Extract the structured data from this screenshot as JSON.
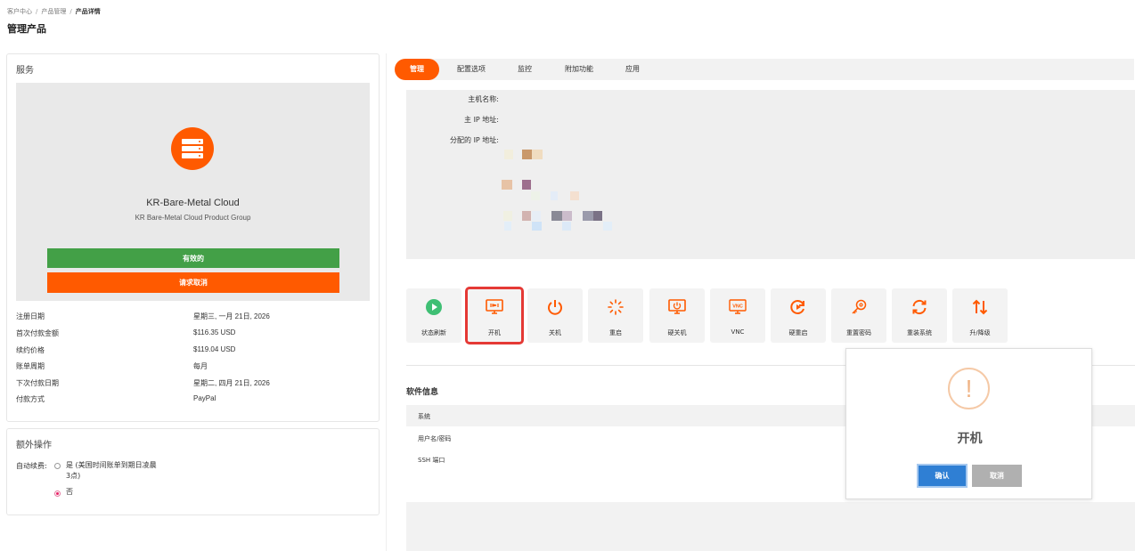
{
  "breadcrumb": {
    "items": [
      "客户中心",
      "产品管理",
      "产品详情"
    ],
    "separator": "/"
  },
  "page_title": "管理产品",
  "service_panel": {
    "title": "服务",
    "product_name": "KR-Bare-Metal Cloud",
    "product_group": "KR Bare-Metal Cloud Product Group",
    "status_label": "有效的",
    "cancel_request_label": "请求取消",
    "icon": "server-icon",
    "details": [
      {
        "key": "注册日期",
        "value": "星期三, 一月 21日, 2026"
      },
      {
        "key": "首次付款金额",
        "value": "$116.35 USD"
      },
      {
        "key": "续约价格",
        "value": "$119.04 USD"
      },
      {
        "key": "账单周期",
        "value": "每月"
      },
      {
        "key": "下次付款日期",
        "value": "星期二, 四月 21日, 2026"
      },
      {
        "key": "付款方式",
        "value": "PayPal"
      }
    ]
  },
  "extra_panel": {
    "title": "额外操作",
    "auto_renew_label": "自动续费:",
    "option_yes_line1": "是 (美国时间账单到期日凌晨",
    "option_yes_line2": "3点)",
    "option_no": "否",
    "selected": "no"
  },
  "tabs": [
    {
      "label": "管理",
      "active": true
    },
    {
      "label": "配置选项",
      "active": false
    },
    {
      "label": "监控",
      "active": false
    },
    {
      "label": "附加功能",
      "active": false
    },
    {
      "label": "应用",
      "active": false
    }
  ],
  "host_info": {
    "hostname_label": "主机名称:",
    "primary_ip_label": "主 IP 地址:",
    "assigned_ip_label": "分配的 IP 地址:"
  },
  "operations": [
    {
      "label": "状态刷新",
      "icon": "refresh-play-icon"
    },
    {
      "label": "开机",
      "icon": "monitor-power-on-icon"
    },
    {
      "label": "关机",
      "icon": "power-icon"
    },
    {
      "label": "重启",
      "icon": "spinner-icon"
    },
    {
      "label": "硬关机",
      "icon": "monitor-power-icon"
    },
    {
      "label": "VNC",
      "icon": "vnc-icon"
    },
    {
      "label": "硬重启",
      "icon": "hard-restart-icon"
    },
    {
      "label": "重置密码",
      "icon": "key-icon"
    },
    {
      "label": "重装系统",
      "icon": "reinstall-icon"
    },
    {
      "label": "升/降级",
      "icon": "up-down-arrows-icon"
    }
  ],
  "software_info": {
    "title": "软件信息",
    "rows": [
      "系统",
      "用户名/密码",
      "SSH 端口"
    ]
  },
  "modal": {
    "title": "开机",
    "confirm_label": "确认",
    "cancel_label": "取消",
    "icon": "warning-icon",
    "icon_glyph": "!"
  },
  "colors": {
    "accent": "#ff5a00",
    "success": "#43a047",
    "confirm": "#2f7fd4",
    "highlight": "#e53935"
  }
}
